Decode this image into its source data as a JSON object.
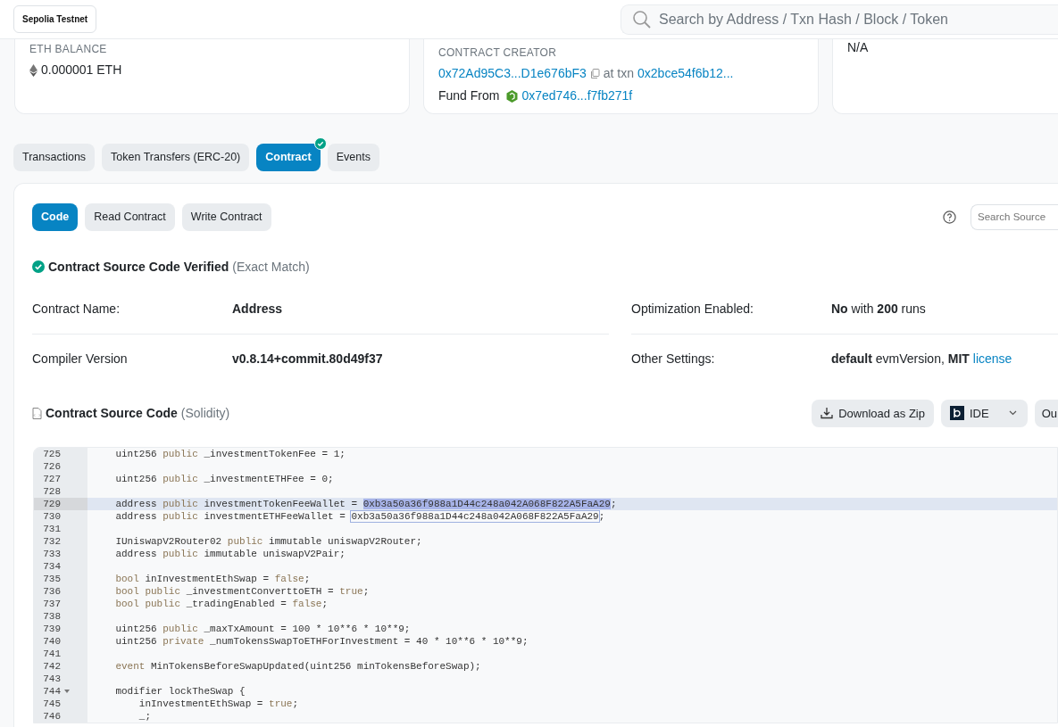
{
  "header": {
    "network_button": "Sepolia Testnet",
    "search": {
      "placeholder": "Search by Address / Txn Hash / Block / Token"
    }
  },
  "overview_cards": [
    {
      "kind": "balance",
      "label": "ETH BALANCE",
      "value": "0.000001 ETH"
    },
    {
      "kind": "creator",
      "label": "CONTRACT CREATOR",
      "creator_link": "0x72Ad95C3...D1e676bF3",
      "at_text": "at txn",
      "txn_link": "0x2bce54f6b12...",
      "fund_label": "Fund From",
      "fund_link": "0x7ed746...f7fb271f"
    },
    {
      "kind": "info",
      "value": "N/A"
    }
  ],
  "tabs": [
    {
      "label": "Transactions",
      "selected": false,
      "verified": false
    },
    {
      "label": "Token Transfers (ERC-20)",
      "selected": false,
      "verified": false
    },
    {
      "label": "Contract",
      "selected": true,
      "verified": true
    },
    {
      "label": "Events",
      "selected": false,
      "verified": false
    }
  ],
  "sub_tabs": [
    {
      "label": "Code",
      "selected": true
    },
    {
      "label": "Read Contract",
      "selected": false
    },
    {
      "label": "Write Contract",
      "selected": false
    }
  ],
  "source_search": {
    "placeholder": "Search Source"
  },
  "verified": {
    "title": "Contract Source Code Verified",
    "note": "(Exact Match)"
  },
  "details": [
    {
      "label": "Contract Name:",
      "value": "Address"
    },
    {
      "label": "Optimization Enabled:",
      "value": "**No** with **200** runs"
    },
    {
      "label": "Compiler Version",
      "value": "v0.8.14+commit.80d49f37"
    },
    {
      "label": "Other Settings:",
      "value": "**default** evmVersion, **MIT**",
      "link": "license"
    }
  ],
  "source_header": {
    "title": "Contract Source Code",
    "language": "(Solidity)"
  },
  "source_buttons": [
    {
      "kind": "download",
      "label": "Download as Zip"
    },
    {
      "kind": "ide",
      "label": "IDE"
    },
    {
      "kind": "plain",
      "label": "Ou"
    }
  ],
  "code_lines": [
    {
      "number": "725",
      "selected": false,
      "segments": [
        {
          "text": "    uint256 ",
          "kind": "plain"
        },
        {
          "text": "public",
          "kind": "keyword"
        },
        {
          "text": " _investmentTokenFee = 1;",
          "kind": "plain"
        }
      ]
    },
    {
      "number": "726",
      "selected": false
    },
    {
      "number": "727",
      "selected": false,
      "segments": [
        {
          "text": "    uint256 ",
          "kind": "plain"
        },
        {
          "text": "public",
          "kind": "keyword"
        },
        {
          "text": " _investmentETHFee = 0;",
          "kind": "plain"
        }
      ]
    },
    {
      "number": "728",
      "selected": false
    },
    {
      "number": "729",
      "selected": true,
      "segments": [
        {
          "text": "    address ",
          "kind": "plain"
        },
        {
          "text": "public",
          "kind": "keyword"
        },
        {
          "text": " investmentTokenFeeWallet = ",
          "kind": "plain"
        },
        {
          "text": "0xb3a50a36f988a1D44c248a042A068F822A5FaA29",
          "kind": "selection"
        },
        {
          "text": ";",
          "kind": "plain"
        }
      ]
    },
    {
      "number": "730",
      "selected": false,
      "segments": [
        {
          "text": "    address ",
          "kind": "plain"
        },
        {
          "text": "public",
          "kind": "keyword"
        },
        {
          "text": " investmentETHFeeWallet = ",
          "kind": "plain"
        },
        {
          "text": "0xb3a50a36f988a1D44c248a042A068F822A5FaA29",
          "kind": "match"
        },
        {
          "text": ";",
          "kind": "plain"
        }
      ]
    },
    {
      "number": "731",
      "selected": false
    },
    {
      "number": "732",
      "selected": false,
      "segments": [
        {
          "text": "    IUniswapV2Router02 ",
          "kind": "plain"
        },
        {
          "text": "public",
          "kind": "keyword"
        },
        {
          "text": " immutable uniswapV2Router;",
          "kind": "plain"
        }
      ]
    },
    {
      "number": "733",
      "selected": false,
      "segments": [
        {
          "text": "    address ",
          "kind": "plain"
        },
        {
          "text": "public",
          "kind": "keyword"
        },
        {
          "text": " immutable uniswapV2Pair;",
          "kind": "plain"
        }
      ]
    },
    {
      "number": "734",
      "selected": false
    },
    {
      "number": "735",
      "selected": false,
      "segments": [
        {
          "text": "    bool",
          "kind": "keyword"
        },
        {
          "text": " inInvestmentEthSwap = ",
          "kind": "plain"
        },
        {
          "text": "false",
          "kind": "keyword"
        },
        {
          "text": ";",
          "kind": "plain"
        }
      ]
    },
    {
      "number": "736",
      "selected": false,
      "segments": [
        {
          "text": "    bool public",
          "kind": "keyword"
        },
        {
          "text": " _investmentConverttoETH = ",
          "kind": "plain"
        },
        {
          "text": "true",
          "kind": "keyword"
        },
        {
          "text": ";",
          "kind": "plain"
        }
      ]
    },
    {
      "number": "737",
      "selected": false,
      "segments": [
        {
          "text": "    bool public",
          "kind": "keyword"
        },
        {
          "text": " _tradingEnabled = ",
          "kind": "plain"
        },
        {
          "text": "false",
          "kind": "keyword"
        },
        {
          "text": ";",
          "kind": "plain"
        }
      ]
    },
    {
      "number": "738",
      "selected": false
    },
    {
      "number": "739",
      "selected": false,
      "segments": [
        {
          "text": "    uint256 ",
          "kind": "plain"
        },
        {
          "text": "public",
          "kind": "keyword"
        },
        {
          "text": " _maxTxAmount = 100 * 10**6 * 10**9;",
          "kind": "plain"
        }
      ]
    },
    {
      "number": "740",
      "selected": false,
      "segments": [
        {
          "text": "    uint256 ",
          "kind": "plain"
        },
        {
          "text": "private",
          "kind": "keyword"
        },
        {
          "text": " _numTokensSwapToETHForInvestment = 40 * 10**6 * 10**9;",
          "kind": "plain"
        }
      ]
    },
    {
      "number": "741",
      "selected": false
    },
    {
      "number": "742",
      "selected": false,
      "segments": [
        {
          "text": "    event",
          "kind": "keyword"
        },
        {
          "text": " MinTokensBeforeSwapUpdated(uint256 minTokensBeforeSwap);",
          "kind": "plain"
        }
      ]
    },
    {
      "number": "743",
      "selected": false
    },
    {
      "number": "744",
      "selected": false,
      "foldable": true,
      "segments": [
        {
          "text": "    modifier lockTheSwap {",
          "kind": "plain"
        }
      ]
    },
    {
      "number": "745",
      "selected": false,
      "segments": [
        {
          "text": "        inInvestmentEthSwap = ",
          "kind": "plain"
        },
        {
          "text": "true",
          "kind": "keyword"
        },
        {
          "text": ";",
          "kind": "plain"
        }
      ]
    },
    {
      "number": "746",
      "selected": false,
      "segments": [
        {
          "text": "        _;",
          "kind": "plain"
        }
      ]
    }
  ]
}
